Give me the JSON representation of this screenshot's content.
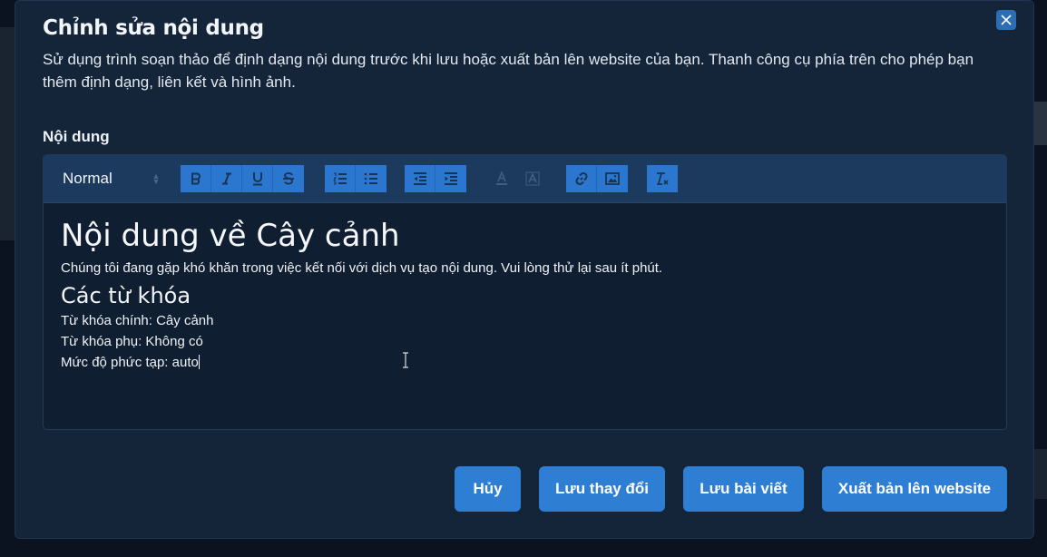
{
  "modal": {
    "title": "Chỉnh sửa nội dung",
    "description": "Sử dụng trình soạn thảo để định dạng nội dung trước khi lưu hoặc xuất bản lên website của bạn. Thanh công cụ phía trên cho phép bạn thêm định dạng, liên kết và hình ảnh.",
    "close_icon": "close-icon"
  },
  "editor": {
    "label": "Nội dung",
    "toolbar": {
      "format_selected": "Normal",
      "buttons": [
        "bold",
        "italic",
        "underline",
        "strike",
        "ordered-list",
        "bullet-list",
        "outdent",
        "indent",
        "text-color",
        "background-color",
        "link",
        "image",
        "clear-format"
      ]
    },
    "content": {
      "heading1": "Nội dung về Cây cảnh",
      "paragraph1": "Chúng tôi đang gặp khó khăn trong việc kết nối với dịch vụ tạo nội dung. Vui lòng thử lại sau ít phút.",
      "heading2": "Các từ khóa",
      "line1": "Từ khóa chính: Cây cảnh",
      "line2": "Từ khóa phụ: Không có",
      "line3": "Mức độ phức tạp: auto"
    }
  },
  "actions": {
    "cancel": "Hủy",
    "save_changes": "Lưu thay đổi",
    "save_post": "Lưu bài viết",
    "publish": "Xuất bản lên website"
  },
  "colors": {
    "modal_bg": "#14253a",
    "toolbar_bg": "#1b3a5d",
    "accent": "#2e7fd4"
  }
}
